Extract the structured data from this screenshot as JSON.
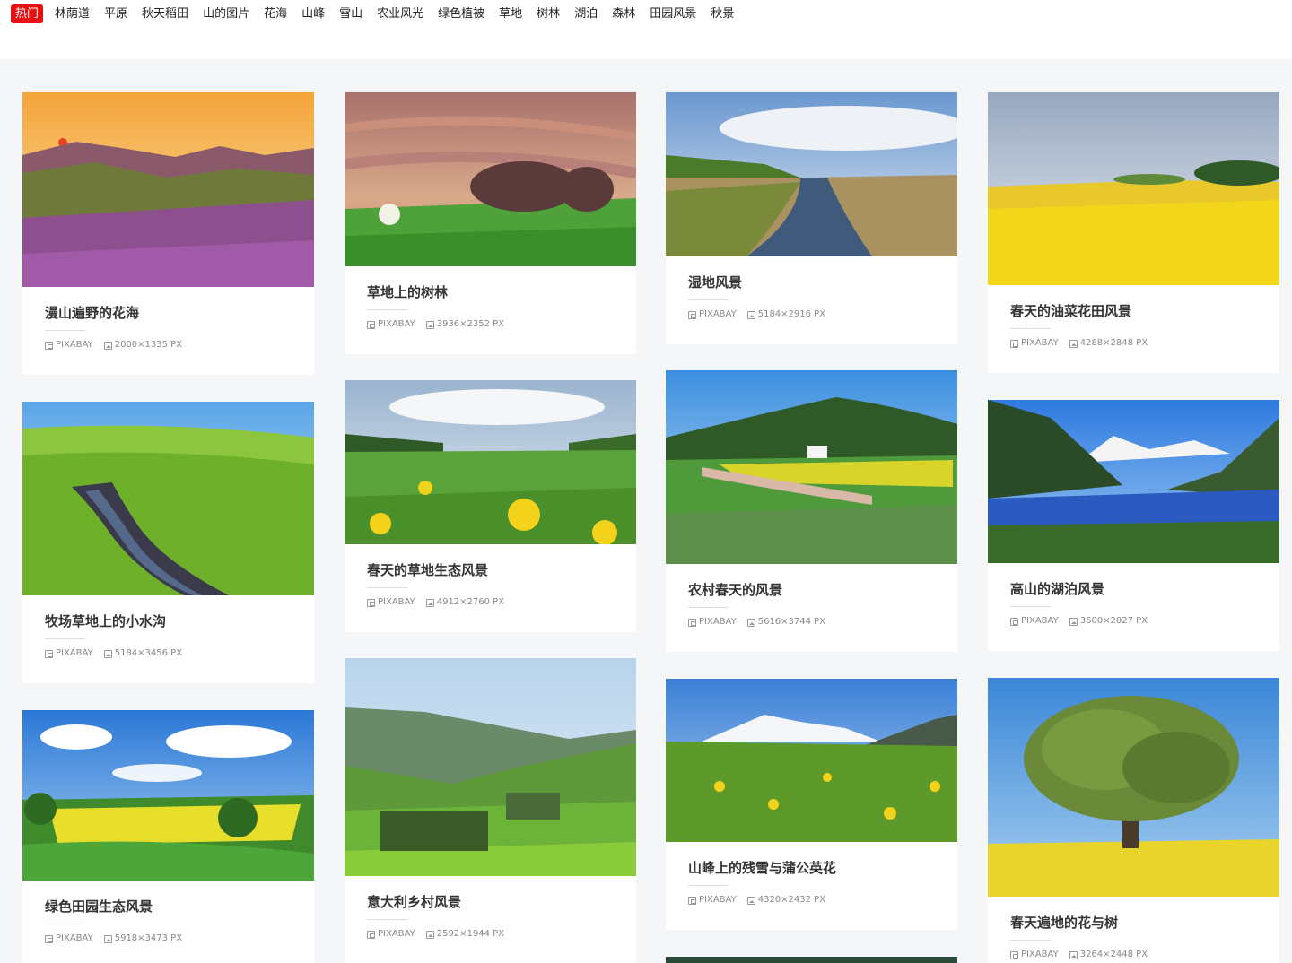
{
  "nav": {
    "tags": [
      "热门",
      "林荫道",
      "平原",
      "秋天稻田",
      "山的图片",
      "花海",
      "山峰",
      "雪山",
      "农业风光",
      "绿色植被",
      "草地",
      "树林",
      "湖泊",
      "森林",
      "田园风景",
      "秋景"
    ]
  },
  "cards": [
    {
      "title": "漫山遍野的花海",
      "source": "PIXABAY",
      "size": "2000×1335 PX"
    },
    {
      "title": "草地上的树林",
      "source": "PIXABAY",
      "size": "3936×2352 PX"
    },
    {
      "title": "湿地风景",
      "source": "PIXABAY",
      "size": "5184×2916 PX"
    },
    {
      "title": "春天的油菜花田风景",
      "source": "PIXABAY",
      "size": "4288×2848 PX"
    },
    {
      "title": "牧场草地上的小水沟",
      "source": "PIXABAY",
      "size": "5184×3456 PX"
    },
    {
      "title": "春天的草地生态风景",
      "source": "PIXABAY",
      "size": "4912×2760 PX"
    },
    {
      "title": "农村春天的风景",
      "source": "PIXABAY",
      "size": "5616×3744 PX"
    },
    {
      "title": "高山的湖泊风景",
      "source": "PIXABAY",
      "size": "3600×2027 PX"
    },
    {
      "title": "绿色田园生态风景",
      "source": "PIXABAY",
      "size": "5918×3473 PX"
    },
    {
      "title": "意大利乡村风景",
      "source": "PIXABAY",
      "size": "2592×1944 PX"
    },
    {
      "title": "山峰上的残雪与蒲公英花",
      "source": "PIXABAY",
      "size": "4320×2432 PX"
    },
    {
      "title": "春天遍地的花与树",
      "source": "PIXABAY",
      "size": "3264×2448 PX"
    }
  ]
}
